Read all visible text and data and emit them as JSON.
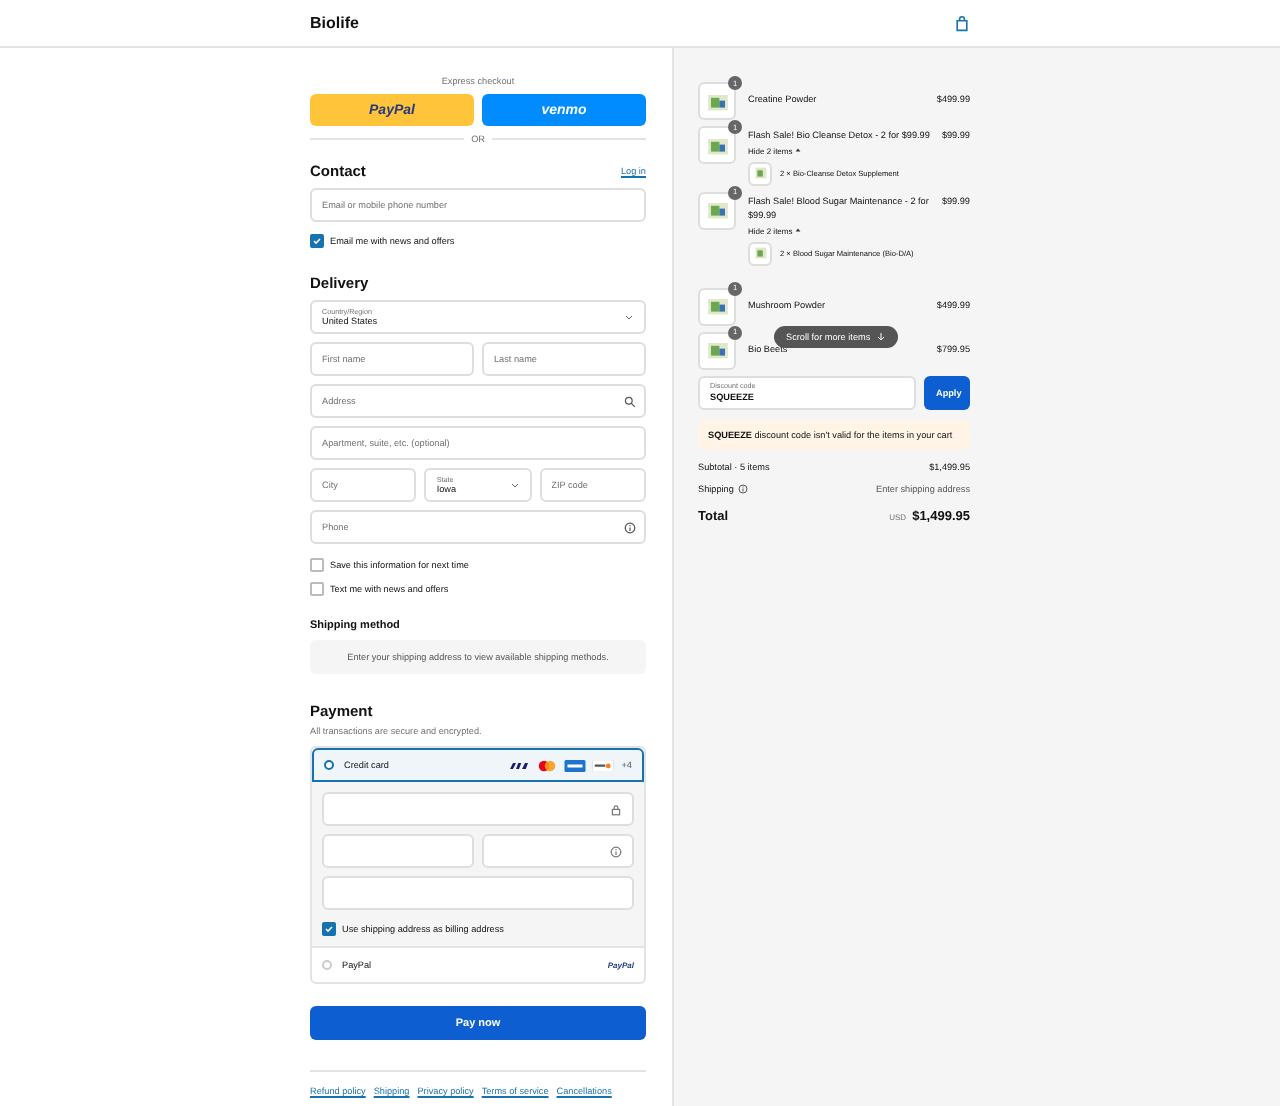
{
  "header": {
    "brand": "Biolife"
  },
  "express": {
    "title": "Express checkout",
    "buttons": [
      {
        "kind": "paypal",
        "label": "PayPal"
      },
      {
        "kind": "venmo",
        "label": "venmo"
      }
    ],
    "divider": "OR"
  },
  "contact": {
    "title": "Contact",
    "link": "Log in",
    "field": {
      "placeholder": "Email or mobile phone number"
    },
    "option": {
      "label": "Email me with news and offers",
      "checked": true
    }
  },
  "delivery": {
    "title": "Delivery",
    "country": {
      "label": "Country/Region",
      "value": "United States"
    },
    "fields": [
      [
        {
          "kind": "text",
          "placeholder": "First name"
        },
        {
          "kind": "text",
          "placeholder": "Last name"
        }
      ],
      [
        {
          "kind": "search",
          "placeholder": "Address"
        }
      ],
      [
        {
          "kind": "text",
          "placeholder": "Apartment, suite, etc. (optional)"
        }
      ],
      [
        {
          "kind": "text",
          "placeholder": "City"
        },
        {
          "kind": "select",
          "label": "State",
          "value": "Iowa"
        },
        {
          "kind": "text",
          "placeholder": "ZIP code"
        }
      ],
      [
        {
          "kind": "help",
          "placeholder": "Phone"
        }
      ]
    ],
    "options": [
      {
        "label": "Save this information for next time",
        "checked": false
      },
      {
        "label": "Text me with news and offers",
        "checked": false
      }
    ]
  },
  "shipping": {
    "title": "Shipping method",
    "notice": "Enter your shipping address to view available shipping methods."
  },
  "payment": {
    "title": "Payment",
    "subtitle": "All transactions are secure and encrypted.",
    "methods": [
      {
        "label": "Credit card",
        "selected": true,
        "more": "+4"
      },
      {
        "label": "PayPal",
        "selected": false,
        "logo": "PayPal"
      }
    ],
    "billing": {
      "label": "Use shipping address as billing address",
      "checked": true
    },
    "pay_button": "Pay now"
  },
  "footer_links": [
    "Refund policy",
    "Shipping",
    "Privacy policy",
    "Terms of service",
    "Cancellations"
  ],
  "order": {
    "items": [
      {
        "name": "Creatine Powder",
        "quantity": "1",
        "price": "$499.99"
      },
      {
        "name": "Flash Sale! Bio Cleanse Detox - 2 for $99.99",
        "quantity": "1",
        "price": "$99.99",
        "toggle": "Hide 2 items",
        "children": [
          {
            "name": "2 × Bio-Cleanse Detox Supplement"
          }
        ]
      },
      {
        "name": "Flash Sale! Blood Sugar Maintenance - 2 for $99.99",
        "quantity": "1",
        "price": "$99.99",
        "toggle": "Hide 2 items",
        "children": [
          {
            "name": "2 × Blood Sugar Maintenance (Bio-D/A)"
          }
        ]
      },
      {
        "name": "Mushroom Powder",
        "quantity": "1",
        "price": "$499.99"
      },
      {
        "name": "Bio Beets",
        "quantity": "1",
        "price": "$799.95"
      }
    ],
    "scroll_hint": "Scroll for more items",
    "discount": {
      "label": "Discount code",
      "value": "SQUEEZE",
      "button": "Apply",
      "error": "**SQUEEZE** discount code isn't valid for the items in your cart"
    },
    "summary": [
      {
        "label": "Subtotal · 5 items",
        "value": "$1,499.95",
        "help": false
      },
      {
        "label": "Shipping",
        "value": "Enter shipping address",
        "help": true
      }
    ],
    "total": {
      "label": "Total",
      "currency": "USD",
      "value": "$1,499.95"
    }
  }
}
